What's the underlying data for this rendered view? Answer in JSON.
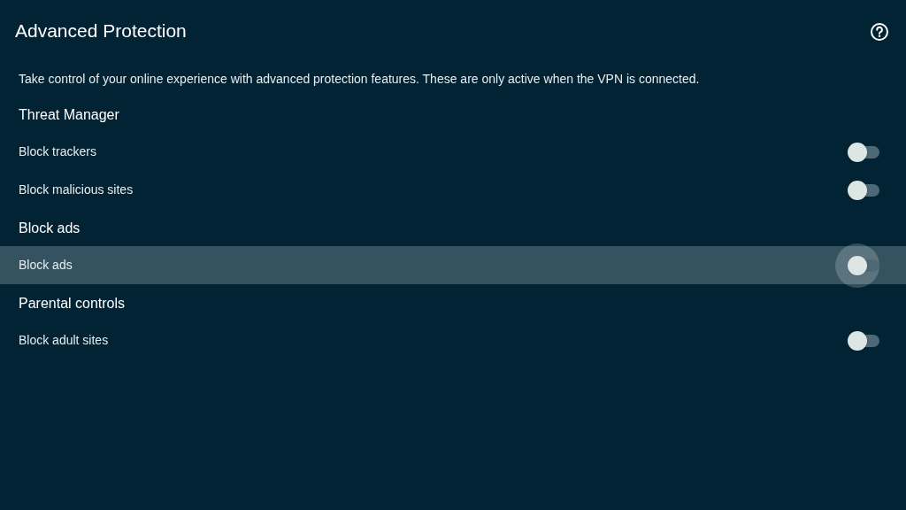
{
  "header": {
    "title": "Advanced Protection"
  },
  "description": "Take control of your online experience with advanced protection features. These are only active when the VPN is connected.",
  "sections": [
    {
      "title": "Threat Manager",
      "items": [
        {
          "label": "Block trackers",
          "on": false,
          "selected": false
        },
        {
          "label": "Block malicious sites",
          "on": false,
          "selected": false
        }
      ]
    },
    {
      "title": "Block ads",
      "items": [
        {
          "label": "Block ads",
          "on": false,
          "selected": true
        }
      ]
    },
    {
      "title": "Parental controls",
      "items": [
        {
          "label": "Block adult sites",
          "on": false,
          "selected": false
        }
      ]
    }
  ]
}
